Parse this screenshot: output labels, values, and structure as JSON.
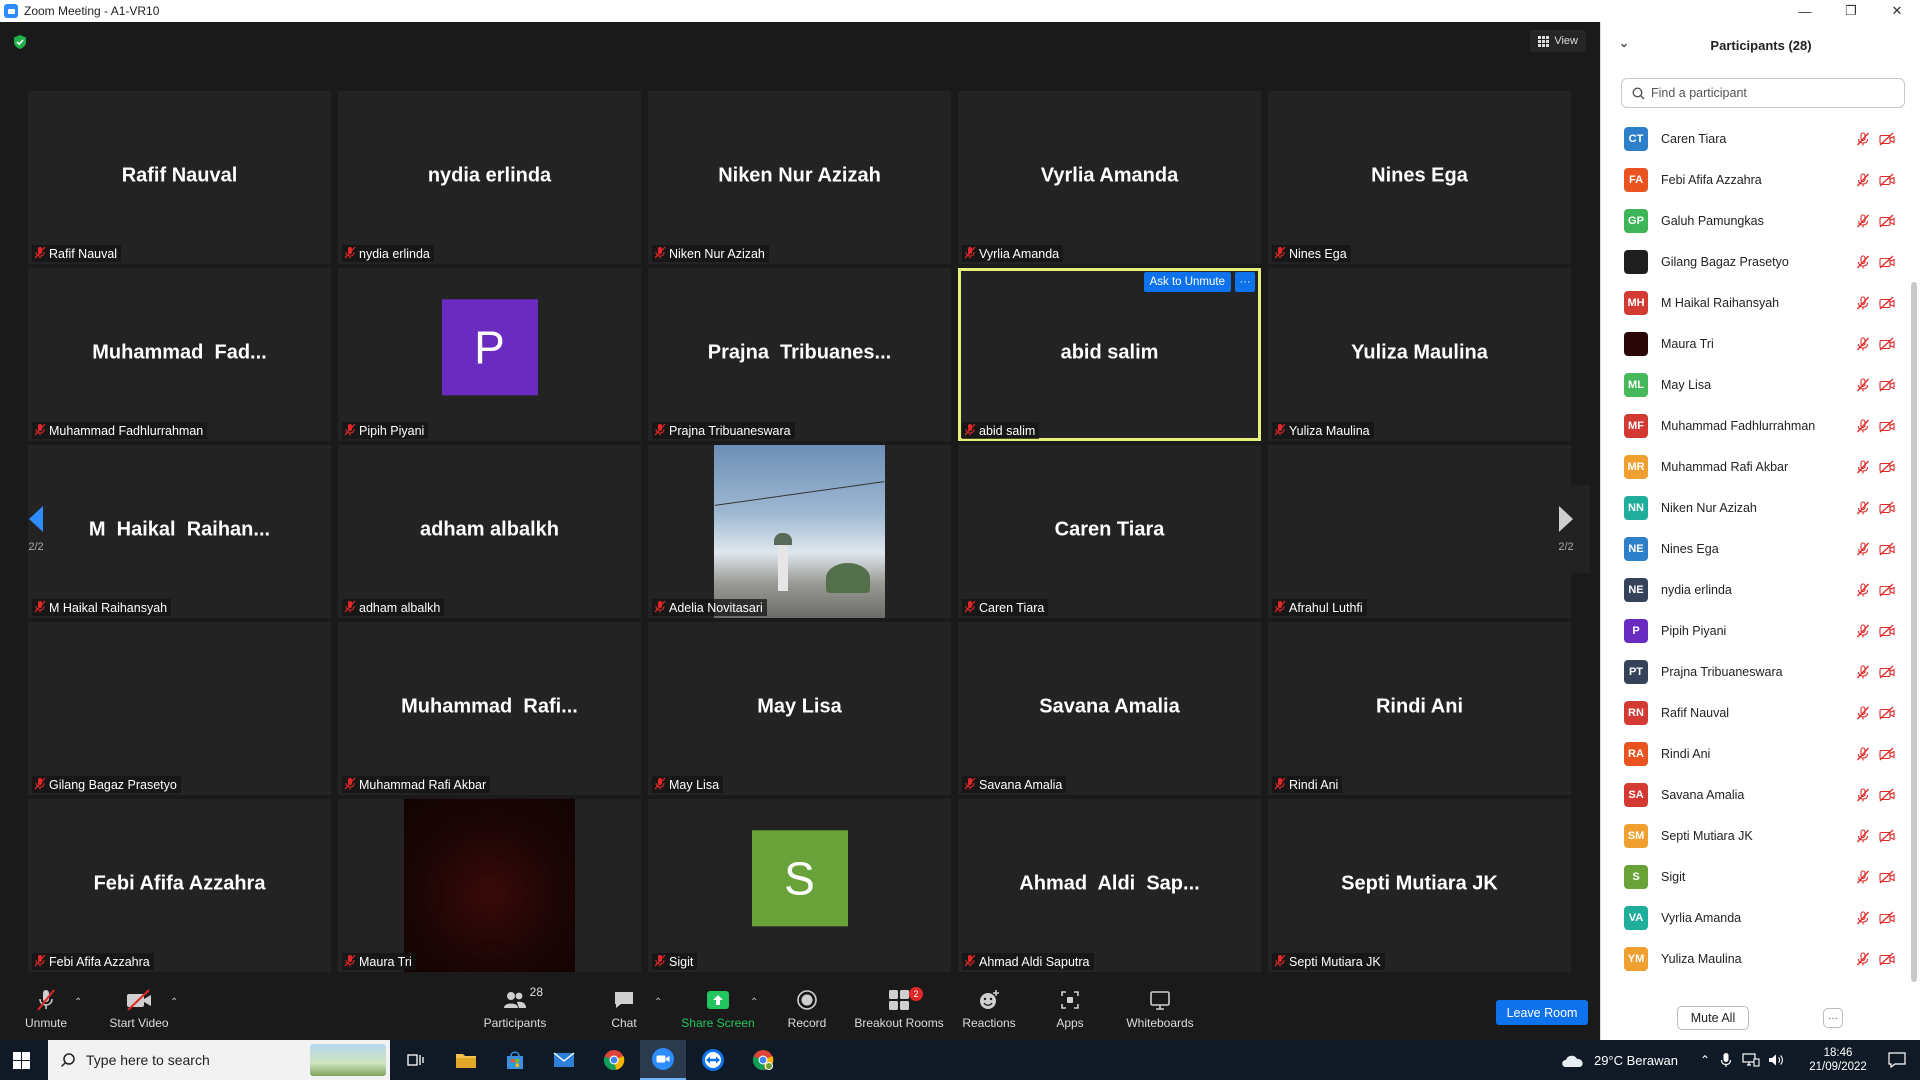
{
  "titlebar": {
    "title": "Zoom Meeting - A1-VR10",
    "controls": [
      "minimize-icon",
      "restore-icon",
      "close-icon"
    ]
  },
  "meeting": {
    "view_label": "View",
    "page_indicator_left": "2/2",
    "page_indicator_right": "2/2",
    "ask_unmute_label": "Ask to Unmute",
    "more_label": "···",
    "active_speaker_color": "#e6f07a",
    "tiles": [
      {
        "big": "Rafif Nauval",
        "label": "Rafif Nauval"
      },
      {
        "big": "nydia erlinda",
        "label": "nydia erlinda"
      },
      {
        "big": "Niken Nur Azizah",
        "label": "Niken Nur Azizah"
      },
      {
        "big": "Vyrlia Amanda",
        "label": "Vyrlia Amanda"
      },
      {
        "big": "Nines Ega",
        "label": "Nines Ega"
      },
      {
        "big": "Muhammad  Fad...",
        "label": "Muhammad Fadhlurrahman"
      },
      {
        "avatar_letter": "P",
        "avatar_color": "#6a2bc0",
        "label": "Pipih Piyani"
      },
      {
        "big": "Prajna  Tribuanes...",
        "label": "Prajna Tribuaneswara"
      },
      {
        "big": "abid salim",
        "label": "abid salim",
        "active": true
      },
      {
        "big": "Yuliza Maulina",
        "label": "Yuliza Maulina"
      },
      {
        "big": "M  Haikal  Raihan...",
        "label": "M Haikal Raihansyah"
      },
      {
        "big": "adham albalkh",
        "label": "adham albalkh"
      },
      {
        "video": "photo",
        "label": "Adelia Novitasari"
      },
      {
        "big": "Caren Tiara",
        "label": "Caren Tiara"
      },
      {
        "big": "",
        "label": "Afrahul Luthfi"
      },
      {
        "big": "",
        "label": "Gilang Bagaz Prasetyo"
      },
      {
        "big": "Muhammad  Rafi...",
        "label": "Muhammad Rafi Akbar"
      },
      {
        "big": "May Lisa",
        "label": "May Lisa"
      },
      {
        "big": "Savana Amalia",
        "label": "Savana Amalia"
      },
      {
        "big": "Rindi Ani",
        "label": "Rindi Ani"
      },
      {
        "big": "Febi Afifa Azzahra",
        "label": "Febi Afifa Azzahra"
      },
      {
        "video": "dark",
        "label": "Maura Tri"
      },
      {
        "avatar_letter": "S",
        "avatar_color": "#6aa23a",
        "label": "Sigit"
      },
      {
        "big": "Ahmad  Aldi  Sap...",
        "label": "Ahmad Aldi Saputra"
      },
      {
        "big": "Septi Mutiara JK",
        "label": "Septi Mutiara JK"
      }
    ]
  },
  "toolbar": {
    "unmute_label": "Unmute",
    "start_video_label": "Start Video",
    "participants_label": "Participants",
    "participants_count": "28",
    "chat_label": "Chat",
    "share_screen_label": "Share Screen",
    "record_label": "Record",
    "breakout_label": "Breakout Rooms",
    "breakout_badge": "2",
    "reactions_label": "Reactions",
    "apps_label": "Apps",
    "whiteboards_label": "Whiteboards",
    "leave_label": "Leave Room",
    "share_color": "#22c55e",
    "leave_color": "#0e72ed"
  },
  "panel": {
    "title": "Participants (28)",
    "search_placeholder": "Find a participant",
    "mute_all_label": "Mute All",
    "more_label": "···",
    "participants": [
      {
        "initials": "CT",
        "name": "Caren Tiara",
        "color": "#2d7fc9"
      },
      {
        "initials": "FA",
        "name": "Febi Afifa Azzahra",
        "color": "#e8531f"
      },
      {
        "initials": "GP",
        "name": "Galuh Pamungkas",
        "color": "#3fb55a"
      },
      {
        "initials": "",
        "name": "Gilang Bagaz Prasetyo",
        "color": "#1e1e1e"
      },
      {
        "initials": "MH",
        "name": "M Haikal Raihansyah",
        "color": "#d23a33"
      },
      {
        "initials": "",
        "name": "Maura Tri",
        "color": "#2a0606"
      },
      {
        "initials": "ML",
        "name": "May Lisa",
        "color": "#44b85a"
      },
      {
        "initials": "MF",
        "name": "Muhammad Fadhlurrahman",
        "color": "#d23a33"
      },
      {
        "initials": "MR",
        "name": "Muhammad Rafi Akbar",
        "color": "#f0a030"
      },
      {
        "initials": "NN",
        "name": "Niken Nur Azizah",
        "color": "#1fae9c"
      },
      {
        "initials": "NE",
        "name": "Nines Ega",
        "color": "#2d7fc9"
      },
      {
        "initials": "NE",
        "name": "nydia erlinda",
        "color": "#34435a"
      },
      {
        "initials": "P",
        "name": "Pipih Piyani",
        "color": "#6a2bc0"
      },
      {
        "initials": "PT",
        "name": "Prajna Tribuaneswara",
        "color": "#34435a"
      },
      {
        "initials": "RN",
        "name": "Rafif Nauval",
        "color": "#d23a33"
      },
      {
        "initials": "RA",
        "name": "Rindi Ani",
        "color": "#e8531f"
      },
      {
        "initials": "SA",
        "name": "Savana Amalia",
        "color": "#d23a33"
      },
      {
        "initials": "SM",
        "name": "Septi Mutiara JK",
        "color": "#f0a030"
      },
      {
        "initials": "S",
        "name": "Sigit",
        "color": "#6aa23a"
      },
      {
        "initials": "VA",
        "name": "Vyrlia Amanda",
        "color": "#1fae9c"
      },
      {
        "initials": "YM",
        "name": "Yuliza Maulina",
        "color": "#f0a030"
      }
    ]
  },
  "taskbar": {
    "search_placeholder": "Type here to search",
    "weather": "29°C  Berawan",
    "time": "18:46",
    "date": "21/09/2022",
    "apps": [
      "task-view-icon",
      "file-explorer-icon",
      "store-icon",
      "mail-icon",
      "chrome-icon",
      "zoom-icon",
      "teamviewer-icon",
      "chrome-profile-icon"
    ]
  }
}
